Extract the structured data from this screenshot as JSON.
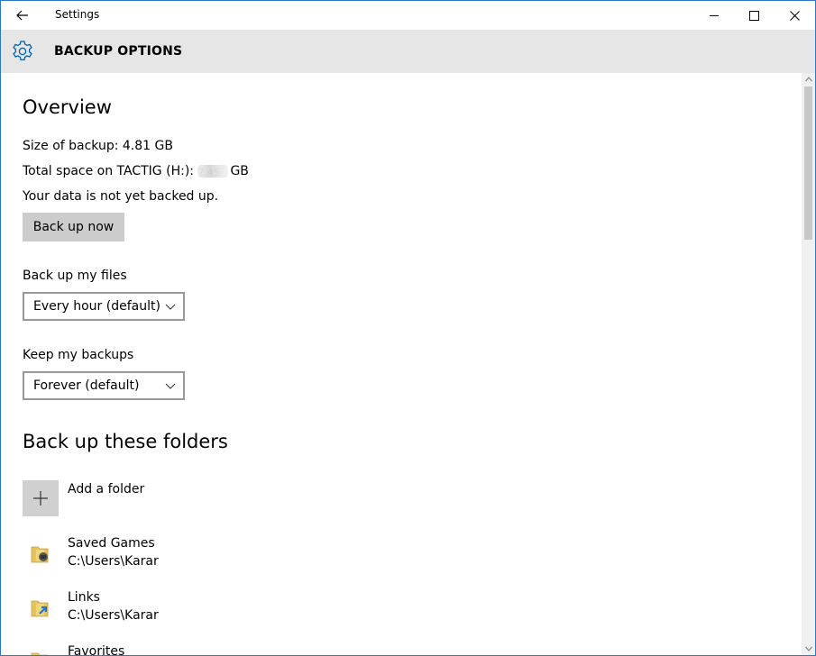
{
  "window": {
    "title": "Settings",
    "controls": {
      "minimize": "minimize-icon",
      "maximize": "maximize-icon",
      "close": "close-icon"
    }
  },
  "header": {
    "icon": "gear-icon",
    "title": "BACKUP OPTIONS",
    "accent_color": "#0063b1"
  },
  "overview": {
    "heading": "Overview",
    "size_of_backup": "Size of backup: 4.81 GB",
    "total_space_prefix": "Total space on TACTIG (H:):",
    "total_space_value": "7.45",
    "total_space_suffix": "GB",
    "status": "Your data is not yet backed up.",
    "back_up_now_label": "Back up now"
  },
  "backup_frequency": {
    "label": "Back up my files",
    "selected": "Every hour (default)"
  },
  "retention": {
    "label": "Keep my backups",
    "selected": "Forever (default)"
  },
  "folders": {
    "heading": "Back up these folders",
    "add_label": "Add a folder",
    "items": [
      {
        "name": "Saved Games",
        "path": "C:\\Users\\Karar"
      },
      {
        "name": "Links",
        "path": "C:\\Users\\Karar"
      },
      {
        "name": "Favorites",
        "path": ""
      }
    ]
  }
}
